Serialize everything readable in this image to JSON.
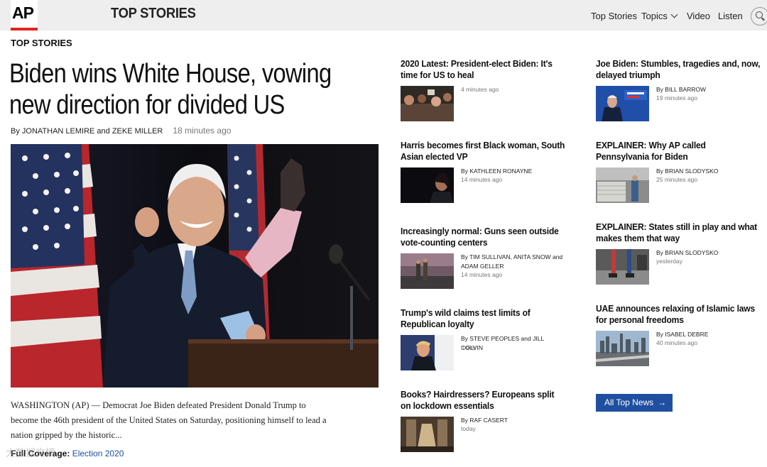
{
  "header": {
    "logo": "AP",
    "section_title": "TOP STORIES",
    "nav": [
      "Top Stories",
      "Topics",
      "Video",
      "Listen"
    ]
  },
  "main": {
    "kicker": "TOP STORIES",
    "headline": "Biden wins White House, vowing new direction for divided US",
    "byline": "By JONATHAN LEMIRE and ZEKE MILLER",
    "time": "18 minutes ago",
    "lede": "WASHINGTON (AP) — Democrat Joe Biden defeated President Donald Trump to become the 46th president of the United States on Saturday, positioning himself to lead a nation gripped by the historic...",
    "full_coverage_label": "Full Coverage:",
    "full_coverage_link": "Election 2020"
  },
  "col1": [
    {
      "title": "2020 Latest: President-elect Biden: It's time for US to heal",
      "byline": "",
      "time": "4 minutes ago"
    },
    {
      "title": "Harris becomes first Black woman, South Asian elected VP",
      "byline": "By KATHLEEN RONAYNE",
      "time": "14 minutes ago"
    },
    {
      "title": "Increasingly normal: Guns seen outside vote-counting centers",
      "byline": "By TIM SULLIVAN, ANITA SNOW and ADAM GELLER",
      "time": "14 minutes ago"
    },
    {
      "title": "Trump's wild claims test limits of Republican loyalty",
      "byline": "By STEVE PEOPLES and JILL COLVIN",
      "time": "today"
    },
    {
      "title": "Books? Hairdressers? Europeans split on lockdown essentials",
      "byline": "By RAF CASERT",
      "time": "today"
    }
  ],
  "col2": [
    {
      "title": "Joe Biden: Stumbles, tragedies and, now, delayed triumph",
      "byline": "By BILL BARROW",
      "time": "19 minutes ago"
    },
    {
      "title": "EXPLAINER: Why AP called Pennsylvania for Biden",
      "byline": "By BRIAN SLODYSKO",
      "time": "25 minutes ago"
    },
    {
      "title": "EXPLAINER: States still in play and what makes them that way",
      "byline": "By BRIAN SLODYSKO",
      "time": "yesterday"
    },
    {
      "title": "UAE announces relaxing of Islamic laws for personal freedoms",
      "byline": "By ISABEL DEBRE",
      "time": "40 minutes ago"
    }
  ],
  "all_news": "All Top News",
  "watermark": "大数据文摘",
  "colors": {
    "accent": "#e0261f",
    "button": "#1f4fa0",
    "link": "#1a4d9e"
  },
  "icons": [
    "chevron-down-icon",
    "search-icon",
    "arrow-right-icon"
  ]
}
